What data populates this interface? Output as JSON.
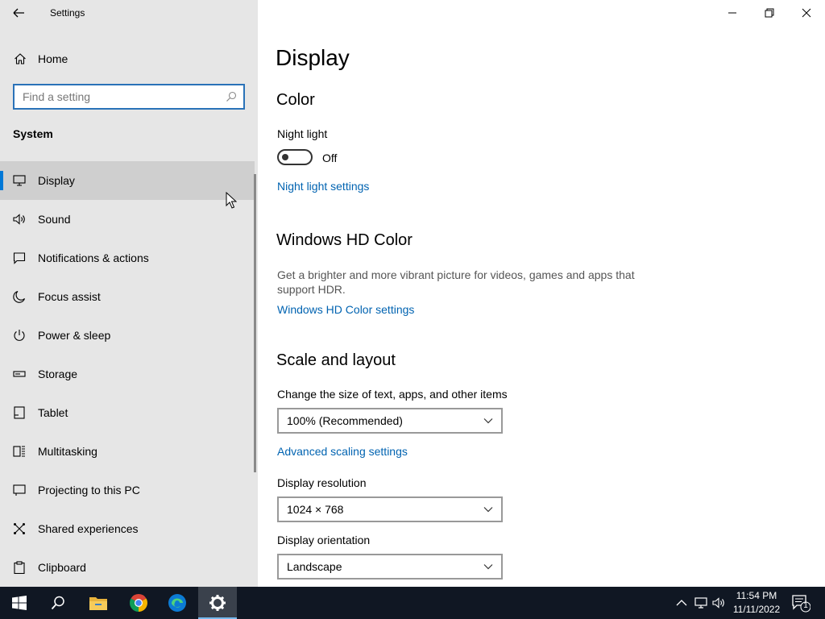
{
  "window": {
    "title": "Settings"
  },
  "sidebar": {
    "home_label": "Home",
    "search_placeholder": "Find a setting",
    "section_title": "System",
    "items": [
      {
        "label": "Display",
        "icon": "monitor-icon",
        "active": true
      },
      {
        "label": "Sound",
        "icon": "speaker-icon"
      },
      {
        "label": "Notifications & actions",
        "icon": "notification-icon"
      },
      {
        "label": "Focus assist",
        "icon": "moon-icon"
      },
      {
        "label": "Power & sleep",
        "icon": "power-icon"
      },
      {
        "label": "Storage",
        "icon": "storage-icon"
      },
      {
        "label": "Tablet",
        "icon": "tablet-icon"
      },
      {
        "label": "Multitasking",
        "icon": "multitasking-icon"
      },
      {
        "label": "Projecting to this PC",
        "icon": "projecting-icon"
      },
      {
        "label": "Shared experiences",
        "icon": "shared-icon"
      },
      {
        "label": "Clipboard",
        "icon": "clipboard-icon"
      }
    ]
  },
  "main": {
    "page_title": "Display",
    "color": {
      "heading": "Color",
      "night_light_label": "Night light",
      "night_light_state": "Off",
      "night_light_link": "Night light settings"
    },
    "hdr": {
      "heading": "Windows HD Color",
      "description": "Get a brighter and more vibrant picture for videos, games and apps that support HDR.",
      "link": "Windows HD Color settings"
    },
    "scale": {
      "heading": "Scale and layout",
      "size_label": "Change the size of text, apps, and other items",
      "size_value": "100% (Recommended)",
      "advanced_link": "Advanced scaling settings",
      "resolution_label": "Display resolution",
      "resolution_value": "1024 × 768",
      "orientation_label": "Display orientation",
      "orientation_value": "Landscape"
    }
  },
  "taskbar": {
    "apps": [
      "start-icon",
      "search-icon",
      "file-explorer-icon",
      "chrome-icon",
      "edge-icon",
      "settings-icon"
    ],
    "time": "11:54 PM",
    "date": "11/11/2022",
    "notification_count": "1"
  },
  "colors": {
    "accent": "#0078d7",
    "link": "#0063b1",
    "sidebar_bg": "#e6e6e6",
    "taskbar_bg": "#101723"
  }
}
